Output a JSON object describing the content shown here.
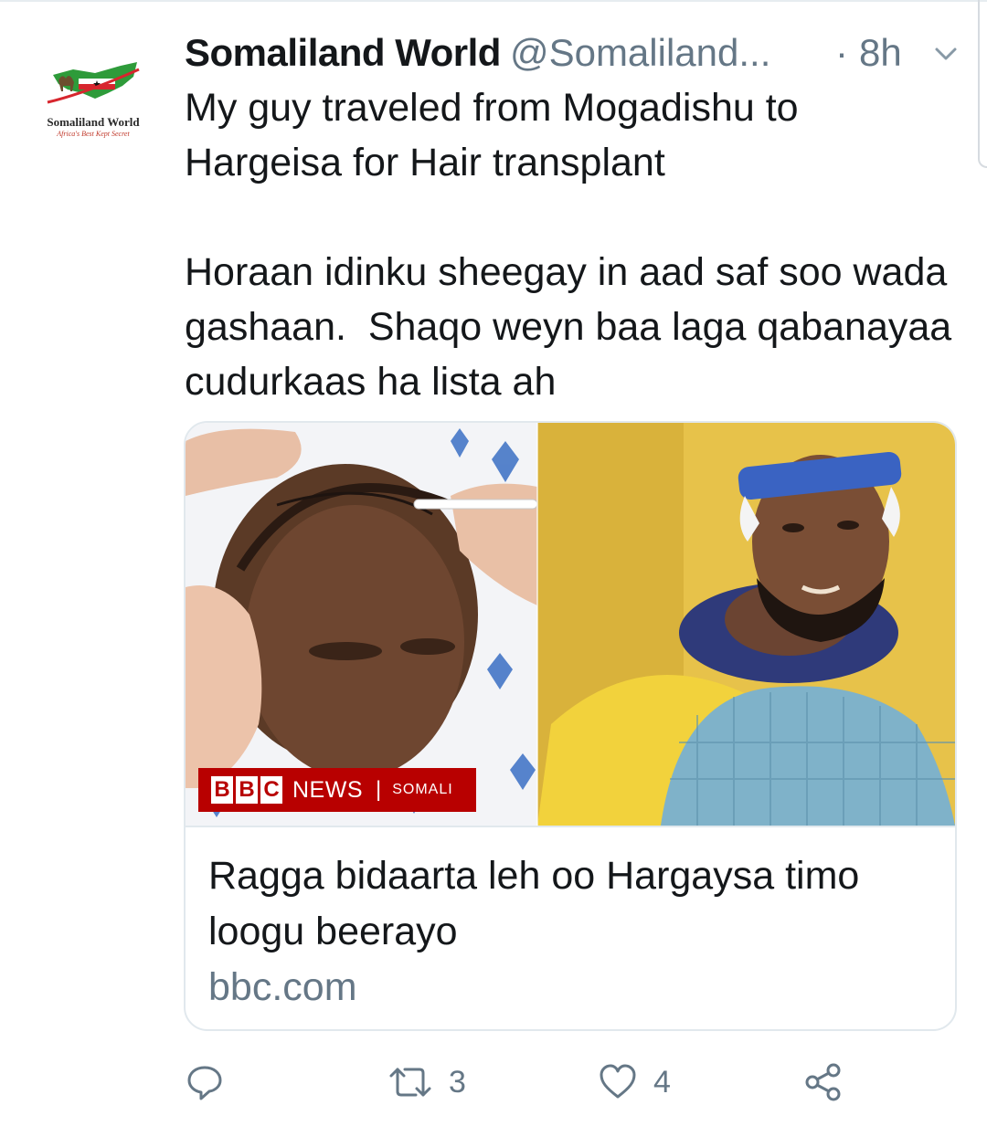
{
  "tweet": {
    "author": {
      "display_name": "Somaliland World",
      "handle": "@Somaliland...",
      "avatar_name": "Somaliland World",
      "avatar_tagline": "Africa's Best Kept Secret"
    },
    "separator": "·",
    "time": "8h",
    "text": "My guy traveled from Mogadishu to Hargeisa for Hair transplant\n\nHoraan idinku sheegay in aad saf soo wada gashaan.  Shaqo weyn baa laga qabanayaa cudurkaas ha lista ah",
    "card": {
      "image_badge": {
        "letters": [
          "B",
          "B",
          "C"
        ],
        "news": "NEWS",
        "separator": "|",
        "section": "SOMALI"
      },
      "title": "Ragga bidaarta leh oo Hargaysa timo loogu beerayo",
      "domain": "bbc.com"
    },
    "actions": {
      "reply": {
        "icon": "reply-icon",
        "count": ""
      },
      "retweet": {
        "icon": "retweet-icon",
        "count": "3"
      },
      "like": {
        "icon": "heart-icon",
        "count": "4"
      },
      "share": {
        "icon": "share-icon",
        "count": ""
      }
    }
  },
  "colors": {
    "text_primary": "#14171a",
    "text_secondary": "#657786",
    "border": "#e1e8ed",
    "bbc_red": "#b80000"
  }
}
